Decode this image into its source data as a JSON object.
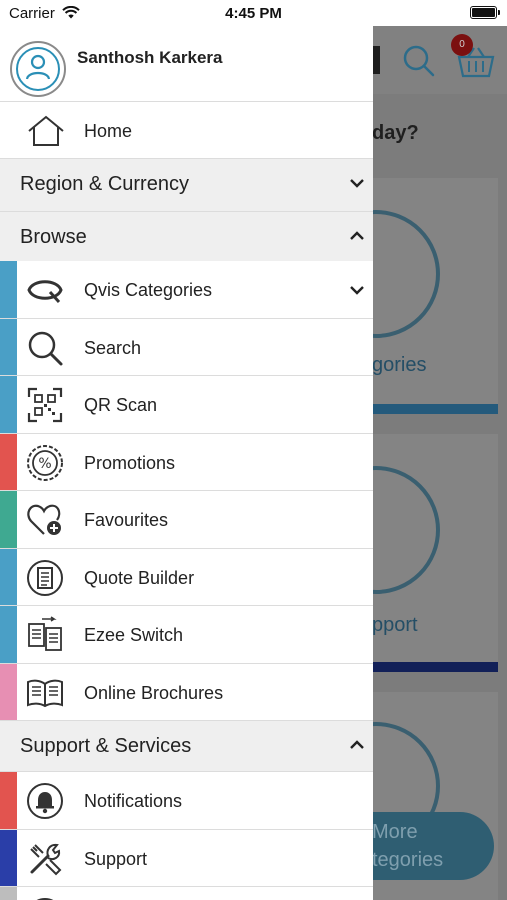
{
  "status_bar": {
    "carrier": "Carrier",
    "time": "4:45 PM"
  },
  "background": {
    "basket_count": "0",
    "subtitle_fragment": "day?",
    "card_labels": [
      "gories",
      "pport"
    ],
    "more_button_lines": [
      "More",
      "tegories"
    ]
  },
  "drawer": {
    "user_name": "Santhosh Karkera",
    "home_label": "Home",
    "sections": {
      "region": {
        "label": "Region & Currency",
        "expanded": false
      },
      "browse": {
        "label": "Browse",
        "expanded": true
      },
      "support": {
        "label": "Support & Services",
        "expanded": true
      }
    },
    "browse_items": [
      {
        "label": "Qvis Categories",
        "icon": "qvis-logo-icon",
        "stripe": "#4a9fc6",
        "has_chevron": true
      },
      {
        "label": "Search",
        "icon": "search-icon",
        "stripe": "#4a9fc6"
      },
      {
        "label": "QR Scan",
        "icon": "qr-code-icon",
        "stripe": "#4a9fc6"
      },
      {
        "label": "Promotions",
        "icon": "percent-badge-icon",
        "stripe": "#e2544f"
      },
      {
        "label": "Favourites",
        "icon": "heart-plus-icon",
        "stripe": "#3fa991"
      },
      {
        "label": "Quote Builder",
        "icon": "document-icon",
        "stripe": "#4a9fc6"
      },
      {
        "label": "Ezee Switch",
        "icon": "switch-documents-icon",
        "stripe": "#4a9fc6"
      },
      {
        "label": "Online Brochures",
        "icon": "open-book-icon",
        "stripe": "#e78fb3"
      }
    ],
    "support_items": [
      {
        "label": "Notifications",
        "icon": "bell-icon",
        "stripe": "#e2544f"
      },
      {
        "label": "Support",
        "icon": "tools-icon",
        "stripe": "#2a3ea8"
      },
      {
        "label": "",
        "icon": "more-icon",
        "stripe": "#bdbdbd"
      }
    ]
  }
}
